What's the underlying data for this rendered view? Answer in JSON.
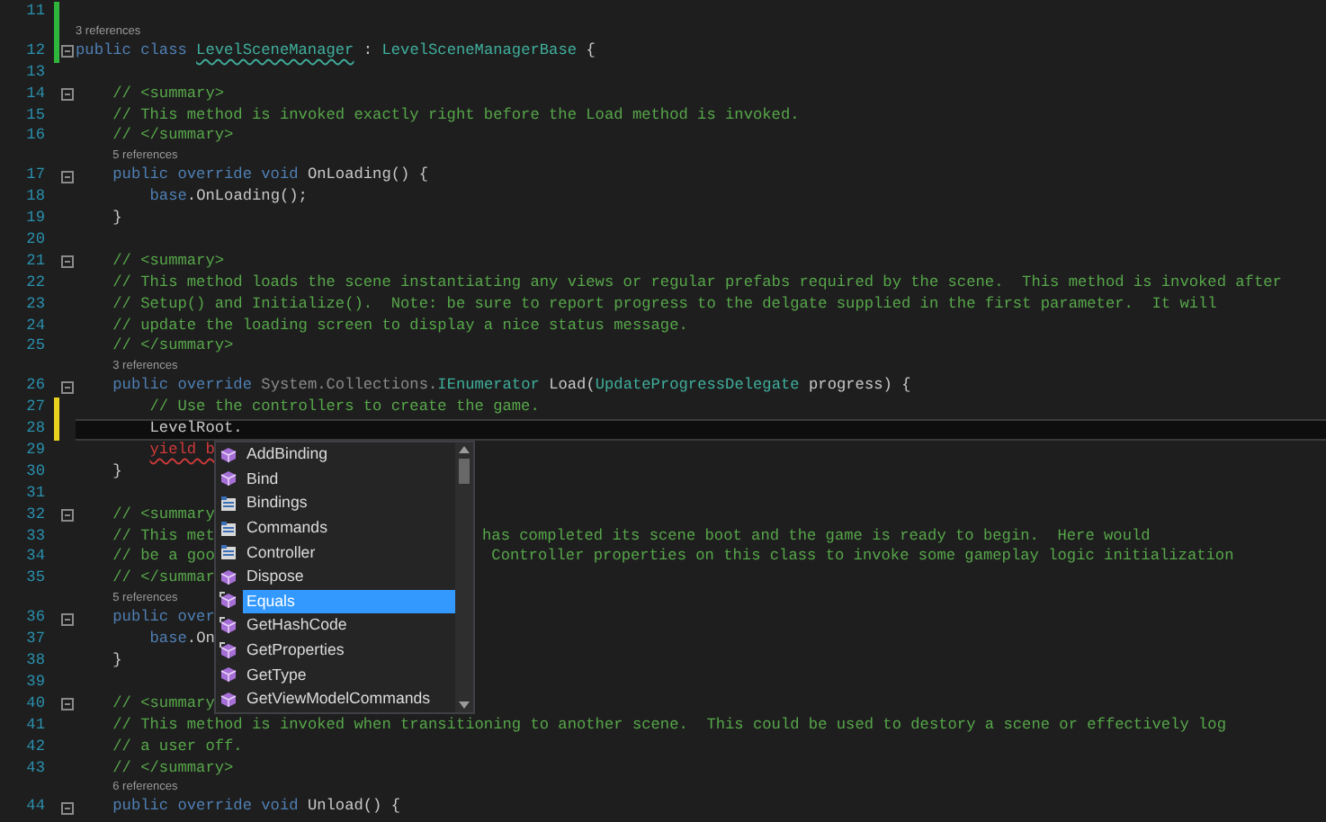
{
  "editor": {
    "lines": [
      {
        "number": "11",
        "color": "#2fb53c"
      },
      {
        "number": "12",
        "color": "#2fb53c",
        "fold": true,
        "lens": "3 references",
        "tokens": [
          {
            "text": "public class ",
            "kind": "keyword"
          },
          {
            "text": "LevelSceneManager",
            "kind": "type",
            "squiggle": true
          },
          {
            "text": " : ",
            "kind": "plain"
          },
          {
            "text": "LevelSceneManagerBase",
            "kind": "type"
          },
          {
            "text": " {",
            "kind": "plain"
          }
        ]
      },
      {
        "number": "13"
      },
      {
        "number": "14",
        "fold": true,
        "tokens": [
          {
            "text": "    // <summary>",
            "kind": "comment"
          }
        ]
      },
      {
        "number": "15",
        "tokens": [
          {
            "text": "    // This method is invoked exactly right before the Load method is invoked.",
            "kind": "comment"
          }
        ]
      },
      {
        "number": "16",
        "tokens": [
          {
            "text": "    // </summary>",
            "kind": "comment"
          }
        ]
      },
      {
        "number": "17",
        "fold": true,
        "lens": "5 references",
        "tokens": [
          {
            "text": "    public override void ",
            "kind": "keyword"
          },
          {
            "text": "OnLoading() {",
            "kind": "plain"
          }
        ]
      },
      {
        "number": "18",
        "tokens": [
          {
            "text": "        base",
            "kind": "keyword"
          },
          {
            "text": ".OnLoading();",
            "kind": "plain"
          }
        ]
      },
      {
        "number": "19",
        "tokens": [
          {
            "text": "    }",
            "kind": "plain"
          }
        ]
      },
      {
        "number": "20"
      },
      {
        "number": "21",
        "fold": true,
        "tokens": [
          {
            "text": "    // <summary>",
            "kind": "comment"
          }
        ]
      },
      {
        "number": "22",
        "tokens": [
          {
            "text": "    // This method loads the scene instantiating any views or regular prefabs required by the scene.  This method is invoked after",
            "kind": "comment"
          }
        ]
      },
      {
        "number": "23",
        "tokens": [
          {
            "text": "    // Setup() and Initialize().  Note: be sure to report progress to the delgate supplied in the first parameter.  It will",
            "kind": "comment"
          }
        ]
      },
      {
        "number": "24",
        "tokens": [
          {
            "text": "    // update the loading screen to display a nice status message.",
            "kind": "comment"
          }
        ]
      },
      {
        "number": "25",
        "tokens": [
          {
            "text": "    // </summary>",
            "kind": "comment"
          }
        ]
      },
      {
        "number": "26",
        "fold": true,
        "lens": "3 references",
        "tokens": [
          {
            "text": "    public override ",
            "kind": "keyword"
          },
          {
            "text": "System.Collections.",
            "kind": "dim"
          },
          {
            "text": "IEnumerator",
            "kind": "type"
          },
          {
            "text": " Load(",
            "kind": "plain"
          },
          {
            "text": "UpdateProgressDelegate",
            "kind": "type"
          },
          {
            "text": " progress) {",
            "kind": "plain"
          }
        ]
      },
      {
        "number": "27",
        "color": "#e8d21d",
        "tokens": [
          {
            "text": "        // Use the controllers to create the game.",
            "kind": "comment"
          }
        ]
      },
      {
        "number": "28",
        "color": "#e8d21d",
        "current": true,
        "tokens": [
          {
            "text": "        LevelRoot.",
            "kind": "plain"
          }
        ]
      },
      {
        "number": "29",
        "tokens": [
          {
            "text": "        yield b",
            "kind": "error",
            "squiggle": true
          }
        ]
      },
      {
        "number": "30",
        "tokens": [
          {
            "text": "    }",
            "kind": "plain"
          }
        ]
      },
      {
        "number": "31"
      },
      {
        "number": "32",
        "fold": true,
        "tokens": [
          {
            "text": "    // <summary",
            "kind": "comment"
          }
        ]
      },
      {
        "number": "33",
        "tokens": [
          {
            "text": "    // This met",
            "kind": "comment"
          }
        ],
        "right": [
          {
            "text": "has completed its scene boot and the game is ready to begin.  Here would",
            "kind": "comment"
          }
        ]
      },
      {
        "number": "34",
        "tokens": [
          {
            "text": "    // be a goo",
            "kind": "comment"
          }
        ],
        "right": [
          {
            "text": " Controller properties on this class to invoke some gameplay logic initialization",
            "kind": "comment"
          }
        ]
      },
      {
        "number": "35",
        "tokens": [
          {
            "text": "    // </summar",
            "kind": "comment"
          }
        ]
      },
      {
        "number": "36",
        "fold": true,
        "lens": "5 references",
        "tokens": [
          {
            "text": "    public over",
            "kind": "keyword"
          }
        ]
      },
      {
        "number": "37",
        "tokens": [
          {
            "text": "        base",
            "kind": "keyword"
          },
          {
            "text": ".On",
            "kind": "plain"
          }
        ]
      },
      {
        "number": "38",
        "tokens": [
          {
            "text": "    }",
            "kind": "plain"
          }
        ]
      },
      {
        "number": "39"
      },
      {
        "number": "40",
        "fold": true,
        "tokens": [
          {
            "text": "    // <summary",
            "kind": "comment"
          }
        ]
      },
      {
        "number": "41",
        "tokens": [
          {
            "text": "    // This method is invoked when transitioning to another scene.  This could be used to destory a scene or effectively log",
            "kind": "comment"
          }
        ]
      },
      {
        "number": "42",
        "tokens": [
          {
            "text": "    // a user off.",
            "kind": "comment"
          }
        ]
      },
      {
        "number": "43",
        "tokens": [
          {
            "text": "    // </summary>",
            "kind": "comment"
          }
        ]
      },
      {
        "number": "44",
        "fold": true,
        "lens": "6 references",
        "tokens": [
          {
            "text": "    public override void ",
            "kind": "keyword"
          },
          {
            "text": "Unload() {",
            "kind": "plain"
          }
        ]
      }
    ]
  },
  "completion": {
    "items": [
      {
        "label": "AddBinding",
        "kind": "method",
        "selected": false
      },
      {
        "label": "Bind",
        "kind": "method",
        "selected": false
      },
      {
        "label": "Bindings",
        "kind": "property",
        "selected": false
      },
      {
        "label": "Commands",
        "kind": "property",
        "selected": false
      },
      {
        "label": "Controller",
        "kind": "property",
        "selected": false
      },
      {
        "label": "Dispose",
        "kind": "method",
        "selected": false
      },
      {
        "label": "Equals",
        "kind": "extension",
        "selected": true
      },
      {
        "label": "GetHashCode",
        "kind": "extension",
        "selected": false
      },
      {
        "label": "GetProperties",
        "kind": "extension",
        "selected": false
      },
      {
        "label": "GetType",
        "kind": "method",
        "selected": false
      },
      {
        "label": "GetViewModelCommands",
        "kind": "method",
        "selected": false
      }
    ]
  }
}
